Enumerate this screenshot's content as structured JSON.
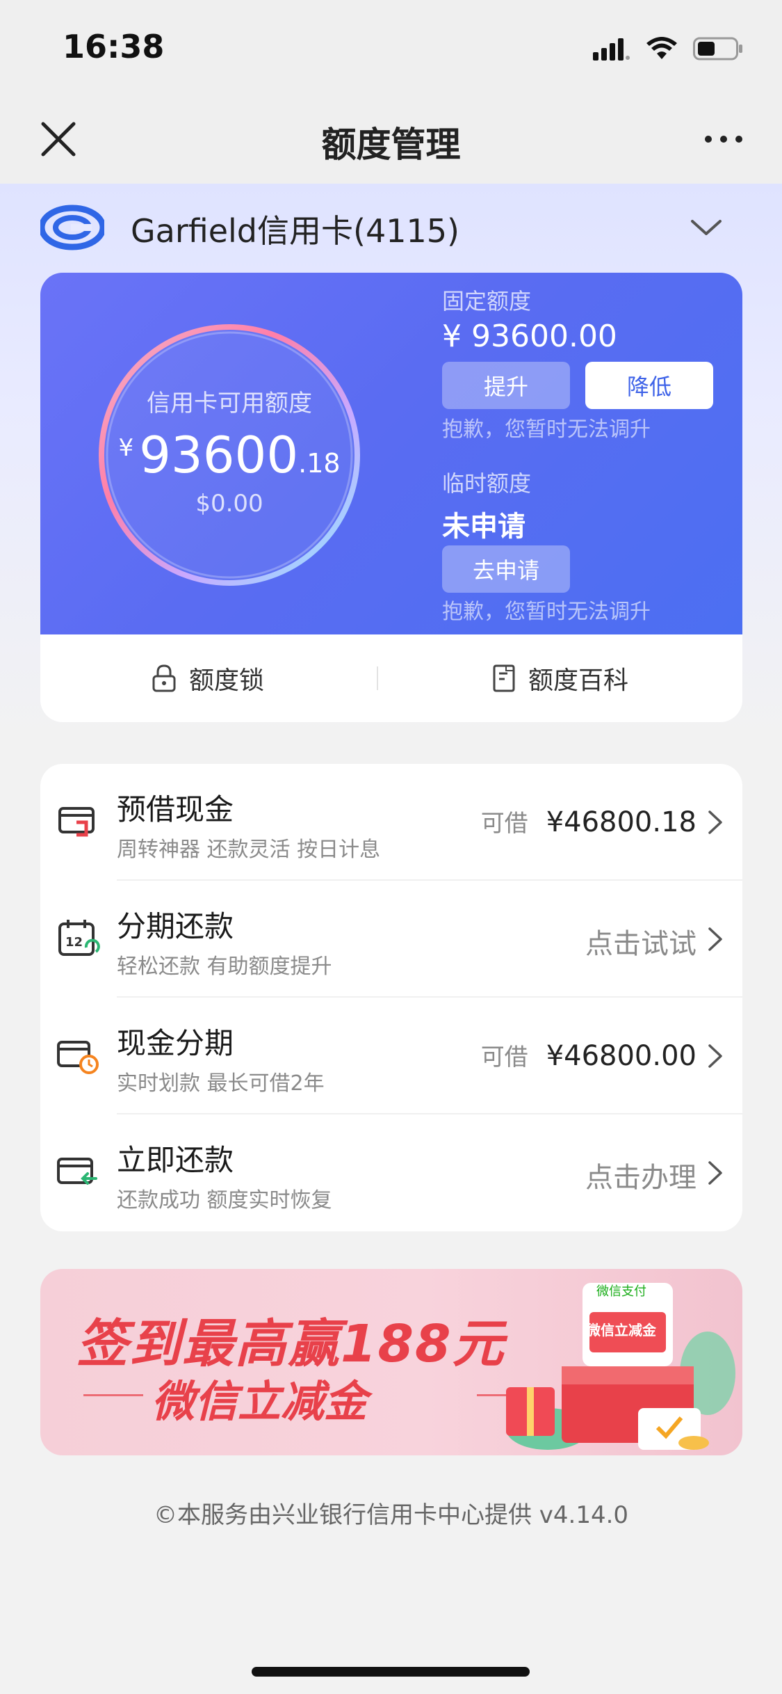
{
  "status": {
    "time": "16:38",
    "icons": [
      "signal-icon",
      "wifi-icon",
      "battery-icon"
    ]
  },
  "nav": {
    "title": "额度管理",
    "close_icon": "close-icon",
    "more_icon": "more-icon"
  },
  "card": {
    "name": "Garfield信用卡(4115)"
  },
  "credit": {
    "available_label": "信用卡可用额度",
    "currency": "¥",
    "available_int": "93600",
    "available_dec": ".18",
    "sub_amount": "$0.00",
    "fixed_label": "固定额度",
    "fixed_value": "¥ 93600.00",
    "raise_label": "提升",
    "lower_label": "降低",
    "fixed_note": "抱歉，您暂时无法调升",
    "temp_label": "临时额度",
    "temp_value": "未申请",
    "apply_label": "去申请",
    "temp_note": "抱歉，您暂时无法调升"
  },
  "actions": {
    "lock_label": "额度锁",
    "wiki_label": "额度百科"
  },
  "services": [
    {
      "title": "预借现金",
      "subtitle": "周转神器 还款灵活 按日计息",
      "prefix": "可借",
      "amount": "¥46800.18",
      "cta": ""
    },
    {
      "title": "分期还款",
      "subtitle": "轻松还款 有助额度提升",
      "prefix": "",
      "amount": "",
      "cta": "点击试试"
    },
    {
      "title": "现金分期",
      "subtitle": "实时划款 最长可借2年",
      "prefix": "可借",
      "amount": "¥46800.00",
      "cta": ""
    },
    {
      "title": "立即还款",
      "subtitle": "还款成功 额度实时恢复",
      "prefix": "",
      "amount": "",
      "cta": "点击办理"
    }
  ],
  "banner": {
    "line1": "签到最高赢188元",
    "line2": "微信立减金",
    "wxpay": "微信支付",
    "coupon": "微信立减金"
  },
  "footer": {
    "text": "©本服务由兴业银行信用卡中心提供 v4.14.0"
  },
  "colors": {
    "accent": "#4c6ff2",
    "banner_red": "#e8414a"
  }
}
